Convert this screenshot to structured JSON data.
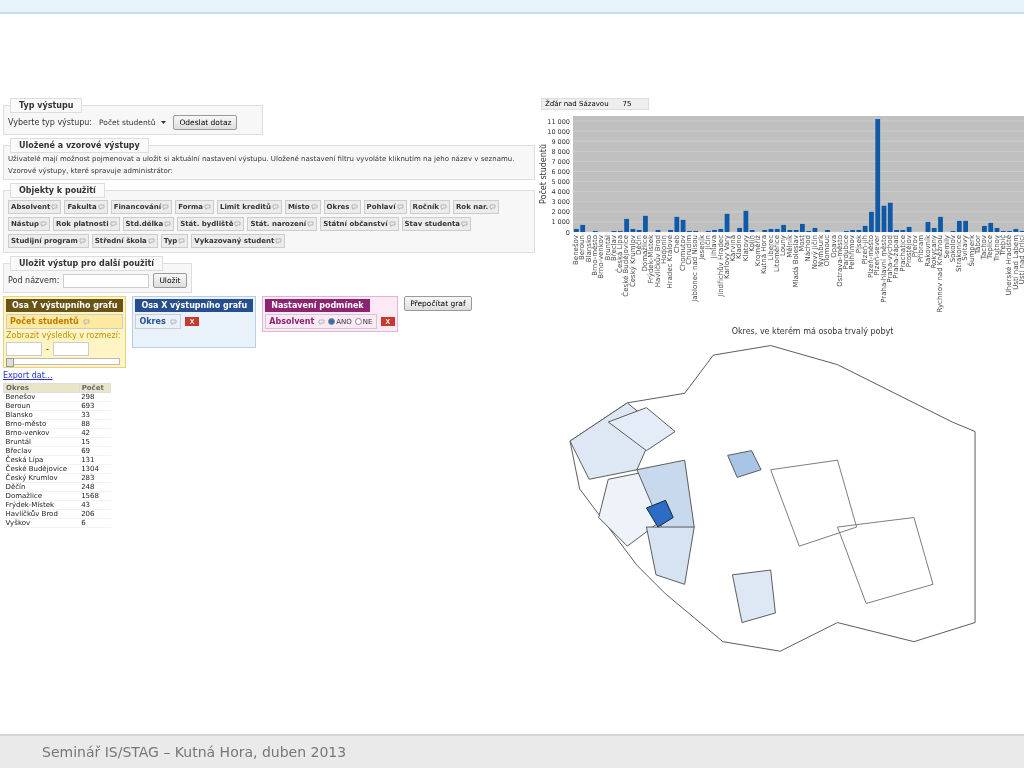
{
  "output_type": {
    "legend": "Typ výstupu",
    "label": "Vyberte typ výstupu:",
    "value": "Počet studentů",
    "submit": "Odeslat dotaz"
  },
  "saved": {
    "legend": "Uložené a vzorové výstupy",
    "text": "Uživatelé mají možnost pojmenovat a uložit si aktuální nastavení výstupu. Uložené nastavení filtru vyvoláte kliknutím na jeho název v seznamu.",
    "text2": "Vzorové výstupy, které spravuje administrátor:"
  },
  "objects": {
    "legend": "Objekty k použití",
    "items": [
      "Absolvent",
      "Fakulta",
      "Financování",
      "Forma",
      "Limit kreditů",
      "Místo",
      "Okres",
      "Pohlaví",
      "Ročník",
      "Rok nar.",
      "Nástup",
      "Rok platnosti",
      "Std.délka",
      "Stát. bydliště",
      "Stát. narození",
      "Státní občanství",
      "Stav studenta",
      "Studijní program",
      "Střední škola",
      "Typ",
      "Vykazovaný student"
    ]
  },
  "save": {
    "legend": "Uložit výstup pro další použití",
    "label": "Pod názvem:",
    "button": "Uložit"
  },
  "axis_y": {
    "title": "Osa Y výstupního grafu",
    "item": "Počet studentů",
    "range_label": "Zobrazit výsledky v rozmezí:",
    "separator": "-",
    "level": 0
  },
  "axis_x": {
    "title": "Osa X výstupního grafu",
    "item": "Okres",
    "remove": "X"
  },
  "conditions": {
    "title": "Nastavení podmínek",
    "item": "Absolvent",
    "options": [
      {
        "label": "ANO",
        "selected": true
      },
      {
        "label": "NE",
        "selected": false
      }
    ],
    "remove": "X"
  },
  "recalc_button": "Přepočítat graf",
  "export_link": "Export dat...",
  "table": {
    "columns": [
      "Okres",
      "Počet"
    ],
    "rows": [
      [
        "Benešov",
        "298"
      ],
      [
        "Beroun",
        "693"
      ],
      [
        "Blansko",
        "33"
      ],
      [
        "Brno-město",
        "88"
      ],
      [
        "Brno-venkov",
        "42"
      ],
      [
        "Bruntál",
        "15"
      ],
      [
        "Břeclav",
        "69"
      ],
      [
        "Česká Lípa",
        "131"
      ],
      [
        "České Budějovice",
        "1304"
      ],
      [
        "Český Krumlov",
        "283"
      ],
      [
        "Děčín",
        "248"
      ],
      [
        "Domažlice",
        "1568"
      ],
      [
        "Frýdek-Místek",
        "43"
      ],
      [
        "Havlíčkův Brod",
        "206"
      ],
      [
        "Vyškov",
        "6"
      ]
    ]
  },
  "chart": {
    "tooltip": {
      "label": "Žďár nad Sázavou",
      "value": "75"
    },
    "chart_data": {
      "type": "bar",
      "grid": true,
      "ylabel": "Počet studentů",
      "ylim": [
        0,
        11500
      ],
      "yticks": [
        {
          "value": 0,
          "label": "0"
        },
        {
          "value": 1000,
          "label": "1 000"
        },
        {
          "value": 2000,
          "label": "2 000"
        },
        {
          "value": 3000,
          "label": "3 000"
        },
        {
          "value": 4000,
          "label": "4 000"
        },
        {
          "value": 5000,
          "label": "5 000"
        },
        {
          "value": 6000,
          "label": "6 000"
        },
        {
          "value": 7000,
          "label": "7 000"
        },
        {
          "value": 8000,
          "label": "8 000"
        },
        {
          "value": 9000,
          "label": "9 000"
        },
        {
          "value": 10000,
          "label": "10 000"
        },
        {
          "value": 11000,
          "label": "11 000"
        }
      ],
      "categories": [
        "Benešov",
        "Beroun",
        "Blansko",
        "Brno-město",
        "Brno-venkov",
        "Bruntál",
        "Břeclav",
        "Česká Lípa",
        "České Budějovice",
        "Český Krumlov",
        "Děčín",
        "Domažlice",
        "Frýdek-Místek",
        "Havlíčkův Brod",
        "Hodonín",
        "Hradec Králové",
        "Cheb",
        "Chomutov",
        "Chrudim",
        "Jablonec nad Nisou",
        "Jeseník",
        "Jičín",
        "Jihlava",
        "Jindřichův Hradec",
        "Karlovy Vary",
        "Karviná",
        "Kladno",
        "Klatovy",
        "Kolín",
        "Kroměříž",
        "Kutná Hora",
        "Liberec",
        "Litoměřice",
        "Louny",
        "Mělník",
        "Mladá Boleslav",
        "Most",
        "Náchod",
        "Nový Jičín",
        "Nymburk",
        "Olomouc",
        "Opava",
        "Ostrava-město",
        "Pardubice",
        "Pelhřimov",
        "Písek",
        "Plzeň-jih",
        "Plzeň-město",
        "Plzeň-sever",
        "Praha-hlavní město",
        "Praha-východ",
        "Praha-západ",
        "Prachatice",
        "Prostějov",
        "Přerov",
        "Příbram",
        "Rakovník",
        "Rokycany",
        "Rychnov nad Kněžnou",
        "Semily",
        "Sokolov",
        "Strakonice",
        "Svitavy",
        "Šumperk",
        "Tábor",
        "Tachov",
        "Teplice",
        "Trutnov",
        "Třebíč",
        "Uherské Hradiště",
        "Ústí nad Labem",
        "Ústí nad Orlicí"
      ],
      "series": [
        {
          "color": "#0f5aa8",
          "values": [
            300,
            700,
            0,
            100,
            0,
            0,
            100,
            100,
            1300,
            300,
            200,
            1600,
            0,
            200,
            0,
            200,
            1500,
            1200,
            100,
            100,
            0,
            100,
            200,
            300,
            1800,
            0,
            400,
            2100,
            200,
            0,
            200,
            300,
            300,
            700,
            200,
            200,
            800,
            100,
            400,
            0,
            200,
            0,
            0,
            100,
            200,
            200,
            600,
            2000,
            11200,
            2600,
            2900,
            200,
            200,
            500,
            0,
            0,
            1000,
            400,
            1500,
            0,
            100,
            1100,
            1100,
            0,
            0,
            600,
            900,
            400,
            100,
            100,
            300,
            100
          ]
        }
      ]
    }
  },
  "map": {
    "title": "Okres, ve kterém má osoba trvalý pobyt"
  },
  "footer": "Seminář IS/STAG – Kutná Hora, duben 2013"
}
